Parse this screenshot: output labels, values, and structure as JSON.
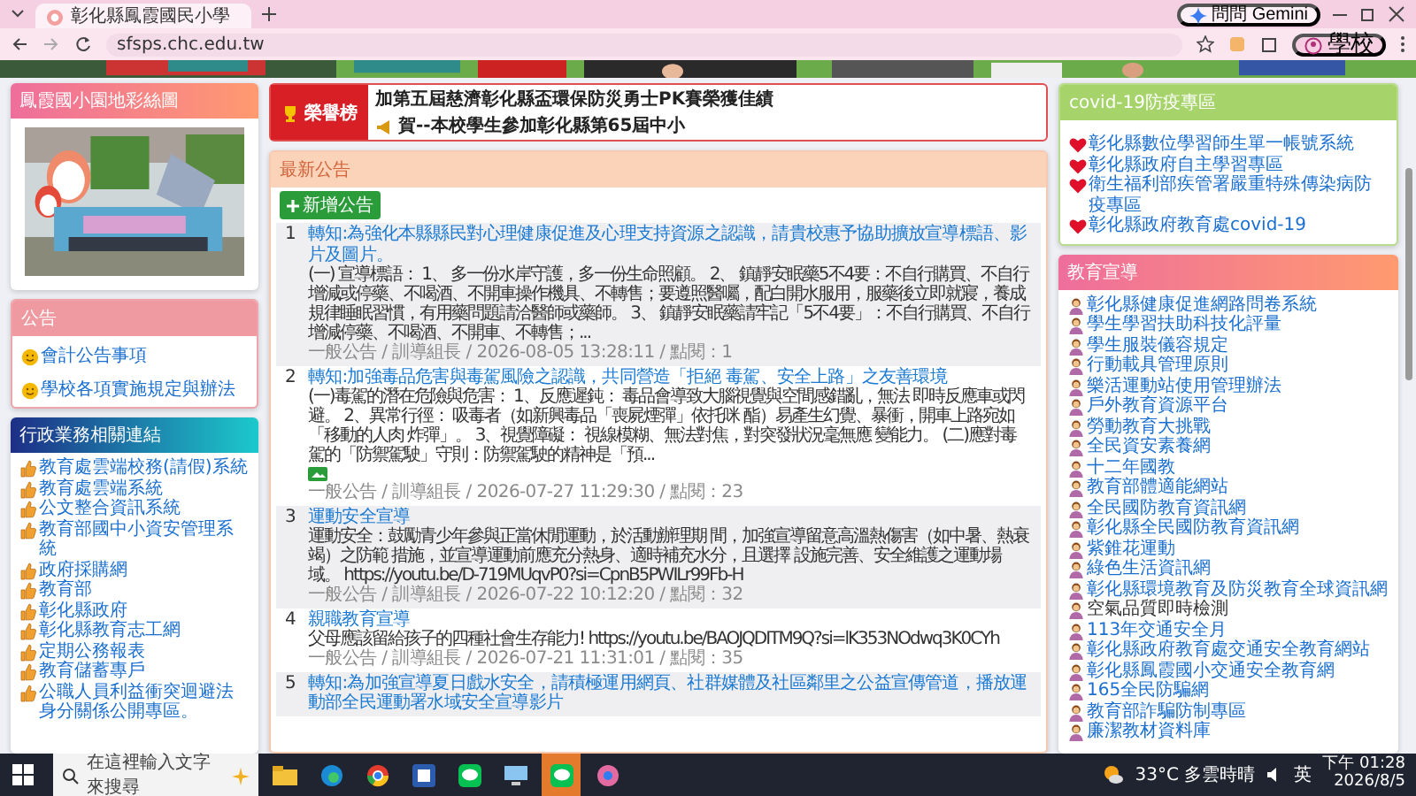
{
  "browser": {
    "tab_title": "彰化縣鳳霞國民小學",
    "url": "sfsps.chc.edu.tw",
    "gemini_button": "問問 Gemini",
    "profile_label": "學校"
  },
  "left": {
    "gallery": {
      "title": "鳳霞國小園地彩絲圖"
    },
    "notices": {
      "title": "公告",
      "items": [
        "會計公告事項",
        "學校各項實施規定與辦法"
      ]
    },
    "admin_links": {
      "title": "行政業務相關連結",
      "items": [
        "教育處雲端校務(請假)系統",
        "教育處雲端系統",
        "公文整合資訊系統",
        "教育部國中小資安管理系統",
        "政府採購網",
        "教育部",
        "彰化縣政府",
        "彰化縣教育志工網",
        "定期公務報表",
        "教育儲蓄專戶",
        "公職人員利益衝突迴避法身分關係公開專區。"
      ]
    }
  },
  "ticker": {
    "label": "榮譽榜",
    "items": [
      "加第五屆慈濟彰化縣盃環保防災勇士PK賽榮獲佳績",
      "賀--本校學生參加彰化縣第65屆中小"
    ]
  },
  "news": {
    "title": "最新公告",
    "add_button": "新增公告",
    "posts": [
      {
        "number": "1",
        "title": "轉知:為強化本縣縣民對心理健康促進及心理支持資源之認識，請貴校惠予協助擴放宣導標語、影片及圖片。",
        "body": "(一) 宣導標語： 1、 多一份水岸守護，多一份生命照顧。 2、 鎮靜安眠藥5不4要：不自行購買、不自行增減或停藥、不喝酒、不開車操作機具、不轉售；要遵照醫囑，配白開水服用，服藥後立即就寢，養成規律睡眠習慣，有用藥問題請洽醫師或藥師。 3、 鎮靜安眠藥請牢記「5不4要」：不自行購買、不自行增減停藥、不喝酒、不開車、不轉售；...",
        "has_image": false,
        "meta": "一般公告 / 訓導組長 / 2026-08-05 13:28:11 / 點閱：1"
      },
      {
        "number": "2",
        "title": "轉知:加強毒品危害與毒駕風險之認識，共同營造「拒絕 毒駕、安全上路」之友善環境",
        "body": "(一)毒駕的潛在危險與危害： 1、反應遲鈍： 毒品會導致大腦視覺與空間感錯亂，無法 即時反應車或閃避。 2、異常行徑： 吸毒者（如新興毒品「喪屍煙彈」依托咪 酯）易產生幻覺、暴衝，開車上路宛如「移動的人肉 炸彈」。 3、視覺障礙： 視線模糊、無法對焦，對突發狀況毫無應 變能力。 (二)應對毒駕的「防禦駕駛」守則：防禦駕駛的精神是「預...",
        "has_image": true,
        "meta": "一般公告 / 訓導組長 / 2026-07-27 11:29:30 / 點閱：23"
      },
      {
        "number": "3",
        "title": "運動安全宣導",
        "body": "運動安全：鼓勵青少年參與正當休閒運動，於活動辦理期 間，加強宣導留意高溫熱傷害（如中暑、熱衰竭）之防範 措施，並宣導運動前應充分熱身、適時補充水分，且選擇 設施完善、安全維護之運動場域。 https://youtu.be/D-719MUqvP0?si=CpnB5PWILr99Fb-H",
        "has_image": false,
        "meta": "一般公告 / 訓導組長 / 2026-07-22 10:12:20 / 點閱：32"
      },
      {
        "number": "4",
        "title": "親職教育宣導",
        "body": "父母應該留給孩子的四種社會生存能力! https://youtu.be/BAOJQDITM9Q?si=lK353NOdwq3K0CYh",
        "has_image": false,
        "meta": "一般公告 / 訓導組長 / 2026-07-21 11:31:01 / 點閱：35"
      },
      {
        "number": "5",
        "title": "轉知:為加強宣導夏日戲水安全，請積極運用網頁、社群媒體及社區鄰里之公益宣傳管道，播放運動部全民運動署水域安全宣導影片",
        "has_image": false
      }
    ]
  },
  "covid": {
    "title": "covid-19防疫專區",
    "items": [
      "彰化縣數位學習師生單一帳號系統",
      "彰化縣政府自主學習專區",
      "衛生福利部疾管署嚴重特殊傳染病防疫專區",
      "彰化縣政府教育處covid-19"
    ]
  },
  "education": {
    "title": "教育宣導",
    "items": [
      {
        "label": "彰化縣健康促進網路問卷系統",
        "visited": false
      },
      {
        "label": "學生學習扶助科技化評量",
        "visited": false
      },
      {
        "label": "學生服裝儀容規定",
        "visited": false
      },
      {
        "label": "行動載具管理原則",
        "visited": false
      },
      {
        "label": "樂活運動站使用管理辦法",
        "visited": false
      },
      {
        "label": "戶外教育資源平台",
        "visited": false
      },
      {
        "label": "勞動教育大挑戰",
        "visited": false
      },
      {
        "label": "全民資安素養網",
        "visited": false
      },
      {
        "label": "十二年國教",
        "visited": false
      },
      {
        "label": "教育部體適能網站",
        "visited": false
      },
      {
        "label": "全民國防教育資訊網",
        "visited": false
      },
      {
        "label": "彰化縣全民國防教育資訊網",
        "visited": false
      },
      {
        "label": "紫錐花運動",
        "visited": false
      },
      {
        "label": "綠色生活資訊網",
        "visited": false
      },
      {
        "label": "彰化縣環境教育及防災教育全球資訊網",
        "visited": false
      },
      {
        "label": "空氣品質即時檢測",
        "visited": true
      },
      {
        "label": "113年交通安全月",
        "visited": false
      },
      {
        "label": "彰化縣政府教育處交通安全教育網站",
        "visited": false
      },
      {
        "label": "彰化縣鳳霞國小交通安全教育網",
        "visited": false
      },
      {
        "label": "165全民防騙網",
        "visited": false
      },
      {
        "label": "教育部詐騙防制專區",
        "visited": false
      },
      {
        "label": "廉潔教材資料庫",
        "visited": false
      }
    ]
  },
  "taskbar": {
    "search_placeholder": "在這裡輸入文字來搜尋",
    "weather": "33°C  多雲時晴",
    "ime": "英",
    "time": "下午 01:28",
    "date": "2026/8/5"
  }
}
